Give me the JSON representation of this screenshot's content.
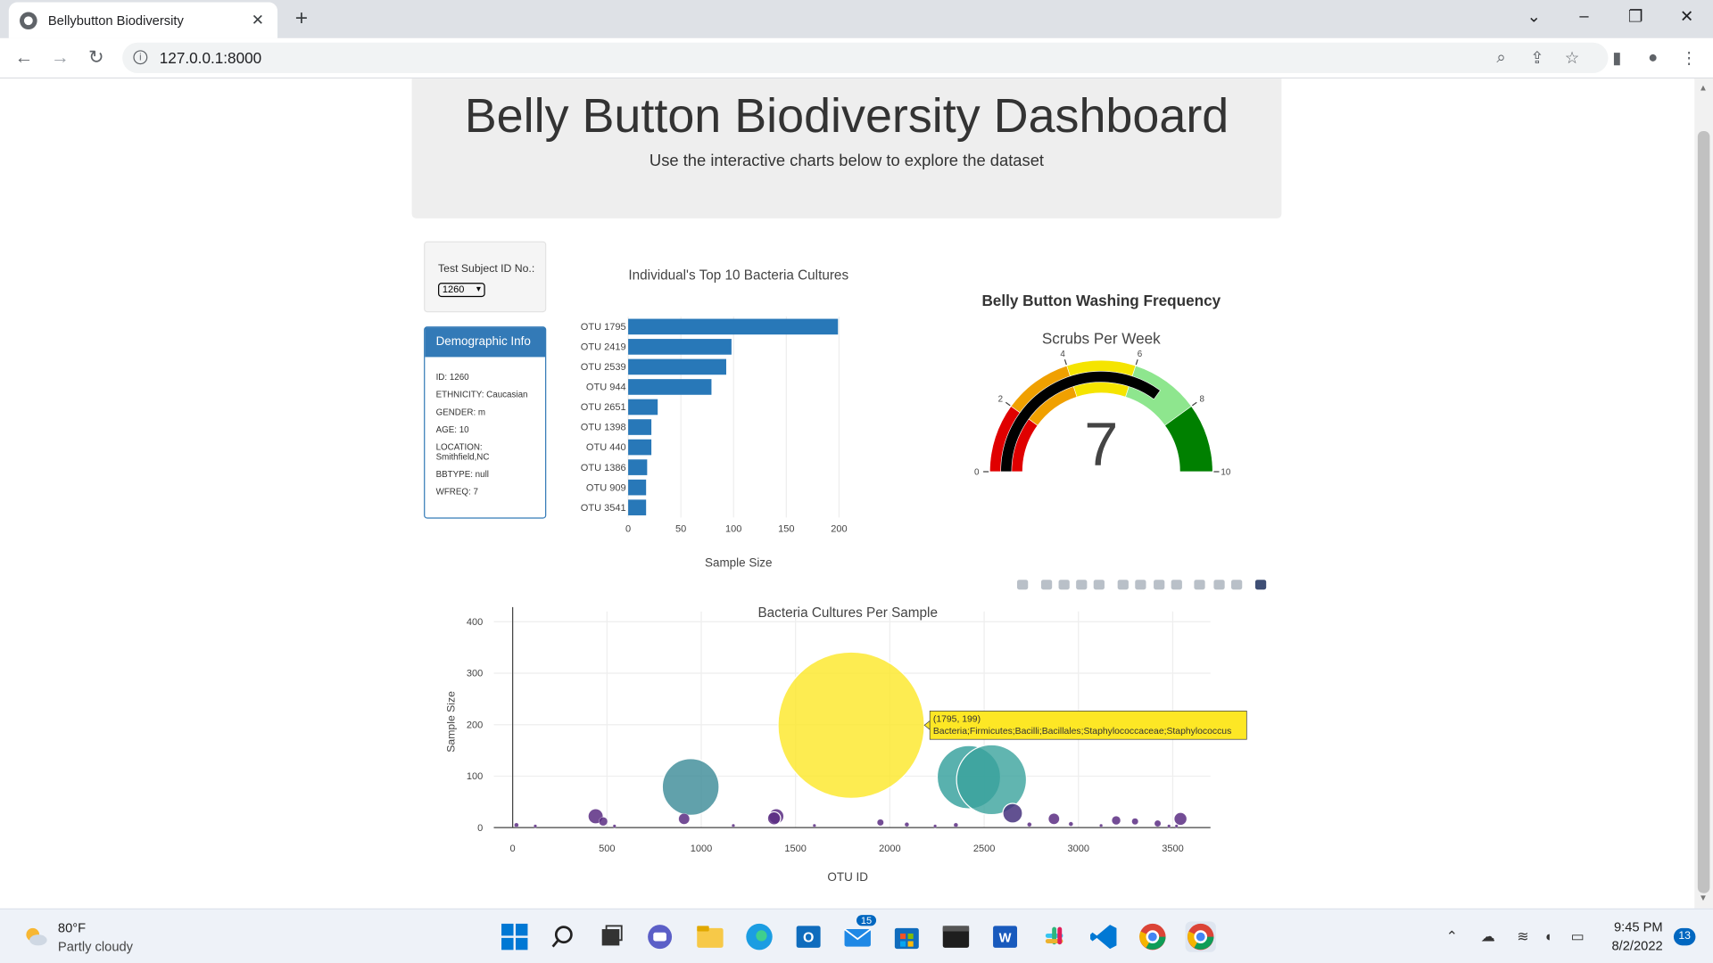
{
  "browser": {
    "tab_title": "Bellybutton Biodiversity",
    "url": "127.0.0.1:8000",
    "new_tab_label": "+",
    "tab_close_label": "✕"
  },
  "header": {
    "title": "Belly Button Biodiversity Dashboard",
    "subtitle": "Use the interactive charts below to explore the dataset"
  },
  "selector": {
    "label": "Test Subject ID No.:",
    "selected": "1260"
  },
  "demographic": {
    "title": "Demographic Info",
    "lines": [
      "ID: 1260",
      "ETHNICITY: Caucasian",
      "GENDER: m",
      "AGE: 10",
      "LOCATION: Smithfield,NC",
      "BBTYPE: null",
      "WFREQ: 7"
    ]
  },
  "bar_chart": {
    "type": "bar",
    "title": "Individual's Top 10 Bacteria Cultures",
    "xlabel": "Sample Size",
    "categories": [
      "OTU 1795",
      "OTU 2419",
      "OTU 2539",
      "OTU 944",
      "OTU 2651",
      "OTU 1398",
      "OTU 440",
      "OTU 1386",
      "OTU 909",
      "OTU 3541"
    ],
    "values": [
      199,
      98,
      93,
      79,
      28,
      22,
      22,
      18,
      17,
      17
    ],
    "xticks": [
      "0",
      "50",
      "100",
      "150",
      "200"
    ],
    "xlim": [
      0,
      200
    ],
    "color": "#2878b8"
  },
  "gauge": {
    "title": "Belly Button Washing Frequency",
    "subtitle": "Scrubs Per Week",
    "value": 7,
    "value_label": "7",
    "range": [
      0,
      10
    ],
    "ticks": [
      "0",
      "2",
      "4",
      "6",
      "8",
      "10"
    ],
    "colors": [
      "#e00000",
      "#f0a000",
      "#f5e400",
      "#8ee68e",
      "#008000"
    ]
  },
  "bubble_chart": {
    "type": "scatter",
    "title": "Bacteria Cultures Per Sample",
    "xlabel": "OTU ID",
    "ylabel": "Sample Size",
    "xticks": [
      "0",
      "500",
      "1000",
      "1500",
      "2000",
      "2500",
      "3000",
      "3500"
    ],
    "yticks": [
      "0",
      "100",
      "200",
      "300",
      "400"
    ],
    "xlim": [
      -100,
      3700
    ],
    "ylim": [
      0,
      420
    ],
    "points": [
      {
        "x": 1795,
        "y": 199,
        "r": 67,
        "color": "#fde725"
      },
      {
        "x": 944,
        "y": 79,
        "r": 26,
        "color": "#3a8a96"
      },
      {
        "x": 2419,
        "y": 98,
        "r": 29,
        "color": "#2f9e9a"
      },
      {
        "x": 2539,
        "y": 93,
        "r": 32,
        "color": "#3aa39c"
      },
      {
        "x": 2651,
        "y": 28,
        "r": 9,
        "color": "#46327e"
      },
      {
        "x": 440,
        "y": 22,
        "r": 7,
        "color": "#5a2d82"
      },
      {
        "x": 1398,
        "y": 22,
        "r": 7,
        "color": "#5a2d82"
      },
      {
        "x": 1386,
        "y": 18,
        "r": 6,
        "color": "#5a2d82"
      },
      {
        "x": 909,
        "y": 17,
        "r": 5,
        "color": "#5a2d82"
      },
      {
        "x": 3541,
        "y": 17,
        "r": 6,
        "color": "#5a2d82"
      },
      {
        "x": 2870,
        "y": 17,
        "r": 5,
        "color": "#5a2d82"
      },
      {
        "x": 3200,
        "y": 14,
        "r": 4,
        "color": "#5a2d82"
      },
      {
        "x": 3300,
        "y": 12,
        "r": 3,
        "color": "#5a2d82"
      },
      {
        "x": 1950,
        "y": 10,
        "r": 3,
        "color": "#5a2d82"
      },
      {
        "x": 480,
        "y": 12,
        "r": 4,
        "color": "#5a2d82"
      },
      {
        "x": 3420,
        "y": 8,
        "r": 3,
        "color": "#5a2d82"
      },
      {
        "x": 2960,
        "y": 7,
        "r": 2,
        "color": "#5a2d82"
      },
      {
        "x": 2740,
        "y": 6,
        "r": 2,
        "color": "#5a2d82"
      },
      {
        "x": 2090,
        "y": 6,
        "r": 2,
        "color": "#5a2d82"
      },
      {
        "x": 2350,
        "y": 5,
        "r": 2,
        "color": "#5a2d82"
      },
      {
        "x": 20,
        "y": 5,
        "r": 2,
        "color": "#5a2d82"
      },
      {
        "x": 120,
        "y": 3,
        "r": 1.5,
        "color": "#5a2d82"
      },
      {
        "x": 1170,
        "y": 4,
        "r": 1.5,
        "color": "#5a2d82"
      },
      {
        "x": 1600,
        "y": 4,
        "r": 1.5,
        "color": "#5a2d82"
      },
      {
        "x": 2240,
        "y": 3,
        "r": 1.5,
        "color": "#5a2d82"
      },
      {
        "x": 3520,
        "y": 3,
        "r": 1.5,
        "color": "#5a2d82"
      },
      {
        "x": 540,
        "y": 3,
        "r": 1.5,
        "color": "#5a2d82"
      },
      {
        "x": 3120,
        "y": 4,
        "r": 1.5,
        "color": "#5a2d82"
      },
      {
        "x": 3480,
        "y": 3,
        "r": 1.5,
        "color": "#5a2d82"
      }
    ],
    "tooltip": {
      "line1": "(1795, 199)",
      "line2": "Bacteria;Firmicutes;Bacilli;Bacillales;Staphylococcaceae;Staphylococcus",
      "color": "#fde725"
    }
  },
  "taskbar": {
    "temperature": "80°F",
    "weather": "Partly cloudy",
    "time": "9:45 PM",
    "date": "8/2/2022",
    "notifications": "13",
    "mail_badge": "15"
  }
}
